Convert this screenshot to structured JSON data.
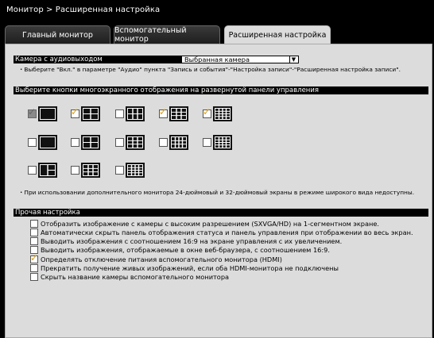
{
  "header": {
    "breadcrumb": "Монитор > Расширенная настройка"
  },
  "tabs": [
    {
      "label": "Главный монитор",
      "active": false
    },
    {
      "label": "Вспомогательный монитор",
      "active": false
    },
    {
      "label": "Расширенная настройка",
      "active": true
    }
  ],
  "audio_camera": {
    "label": "Камера с аудиовыходом",
    "selected": "Выбранная камера",
    "note": "・Выберите \"Вкл.\" в параметре \"Аудио\" пункта \"Запись и события\"-\"Настройка записи\"-\"Расширенная настройка записи\"."
  },
  "multiscreen": {
    "label": "Выберите кнопки многоэкранного отображения на развернутой панели управления",
    "rows": [
      [
        {
          "layout": "1",
          "state": "disabled"
        },
        {
          "layout": "4",
          "state": "checked"
        },
        {
          "layout": "6",
          "state": "unchecked"
        },
        {
          "layout": "9",
          "state": "checked"
        },
        {
          "layout": "16",
          "state": "checked"
        }
      ],
      [
        {
          "layout": "1w",
          "state": "unchecked"
        },
        {
          "layout": "4w",
          "state": "unchecked"
        },
        {
          "layout": "9w",
          "state": "unchecked"
        },
        {
          "layout": "12w",
          "state": "unchecked"
        },
        {
          "layout": "16w",
          "state": "unchecked"
        }
      ],
      [
        {
          "layout": "4-big",
          "state": "unchecked"
        },
        {
          "layout": "8",
          "state": "unchecked"
        },
        {
          "layout": "13",
          "state": "unchecked"
        }
      ]
    ],
    "note": "・При использовании дополнительного монитора 24-дюймовый и 32-дюймовый экраны в режиме широкого вида недоступны."
  },
  "other": {
    "label": "Прочая настройка",
    "options": [
      {
        "label": "Отобразить изображение с камеры с высоким разрешением (SXVGA/HD) на 1-сегментном экране.",
        "checked": false
      },
      {
        "label": "Автоматически скрыть панель отображения статуса и панель управления при отображении во весь экран.",
        "checked": false
      },
      {
        "label": "Выводить изображения с соотношением 16:9 на экране управления с их увеличением.",
        "checked": false
      },
      {
        "label": "Выводить изображения, отображаемые в окне веб-браузера, с соотношением 16:9.",
        "checked": false
      },
      {
        "label": "Определять отключение питания вспомогательного монитора (HDMI)",
        "checked": true
      },
      {
        "label": "Прекратить получение живых изображений, если оба HDMI-монитора не подключены",
        "checked": false
      },
      {
        "label": "Скрыть название камеры вспомогательного монитора",
        "checked": false
      }
    ]
  },
  "colors": {
    "check": "#e8a000",
    "panel": "#dcdcdc",
    "bar": "#000000"
  }
}
